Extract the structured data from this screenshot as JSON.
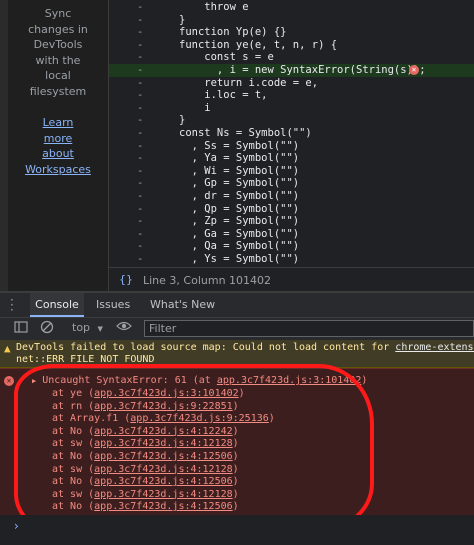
{
  "sidebar": {
    "lines": [
      "Sync",
      "changes in",
      "DevTools",
      "with the",
      "local",
      "filesystem"
    ],
    "link_lines": [
      "Learn",
      "more",
      "about",
      "Workspaces"
    ]
  },
  "editor": {
    "lines": [
      {
        "gutter": "-",
        "code": "    throw e"
      },
      {
        "gutter": "-",
        "code": "}"
      },
      {
        "gutter": "-",
        "code": "function Yp(e) {}"
      },
      {
        "gutter": "-",
        "code": "function ye(e, t, n, r) {"
      },
      {
        "gutter": "-",
        "code": "    const s = e"
      },
      {
        "gutter": "-",
        "code": "      , i = new SyntaxError(String(s));",
        "highlight": true,
        "error": true
      },
      {
        "gutter": "-",
        "code": "    return i.code = e,"
      },
      {
        "gutter": "-",
        "code": "    i.loc = t,"
      },
      {
        "gutter": "-",
        "code": "    i"
      },
      {
        "gutter": "-",
        "code": "}"
      },
      {
        "gutter": "-",
        "code": "const Ns = Symbol(\"\")"
      },
      {
        "gutter": "-",
        "code": "  , Ss = Symbol(\"\")"
      },
      {
        "gutter": "-",
        "code": "  , Ya = Symbol(\"\")"
      },
      {
        "gutter": "-",
        "code": "  , Wi = Symbol(\"\")"
      },
      {
        "gutter": "-",
        "code": "  , Gp = Symbol(\"\")"
      },
      {
        "gutter": "-",
        "code": "  , dr = Symbol(\"\")"
      },
      {
        "gutter": "-",
        "code": "  , Qp = Symbol(\"\")"
      },
      {
        "gutter": "-",
        "code": "  , Zp = Symbol(\"\")"
      },
      {
        "gutter": "-",
        "code": "  , Ga = Symbol(\"\")"
      },
      {
        "gutter": "-",
        "code": "  , Qa = Symbol(\"\")"
      },
      {
        "gutter": "-",
        "code": "  , Ys = Symbol(\"\")"
      }
    ],
    "error_glyph": "✕"
  },
  "status": {
    "braces": "{}",
    "position": "Line 3, Column 101402"
  },
  "tabs": [
    "Console",
    "Issues",
    "What's New"
  ],
  "toolbar": {
    "context": "top",
    "context_arrow": "▼",
    "filter_placeholder": "Filter"
  },
  "warning": {
    "icon": "▲",
    "text": "DevTools failed to load source map: Could not load content for ",
    "link": "chrome-extensi",
    "line2": "net::ERR_FILE_NOT_FOUND"
  },
  "error": {
    "icon": "✕",
    "arrow": "▶",
    "message": "Uncaught SyntaxError: 61 (at ",
    "message_link": "app.3c7f423d.js:3:101402",
    "message_close": ")",
    "frames": [
      {
        "prefix": "at ye (",
        "link": "app.3c7f423d.js:3:101402",
        "suffix": ")"
      },
      {
        "prefix": "at rn (",
        "link": "app.3c7f423d.js:9:22851",
        "suffix": ")"
      },
      {
        "prefix": "at Array.f1 (",
        "link": "app.3c7f423d.js:9:25136",
        "suffix": ")"
      },
      {
        "prefix": "at No (",
        "link": "app.3c7f423d.js:4:12242",
        "suffix": ")"
      },
      {
        "prefix": "at sw (",
        "link": "app.3c7f423d.js:4:12128",
        "suffix": ")"
      },
      {
        "prefix": "at No (",
        "link": "app.3c7f423d.js:4:12506",
        "suffix": ")"
      },
      {
        "prefix": "at sw (",
        "link": "app.3c7f423d.js:4:12128",
        "suffix": ")"
      },
      {
        "prefix": "at No (",
        "link": "app.3c7f423d.js:4:12506",
        "suffix": ")"
      },
      {
        "prefix": "at sw (",
        "link": "app.3c7f423d.js:4:12128",
        "suffix": ")"
      },
      {
        "prefix": "at No (",
        "link": "app.3c7f423d.js:4:12506",
        "suffix": ")"
      }
    ]
  },
  "prompt": {
    "caret": "›"
  },
  "colors": {
    "annotation": "#ff1a1a",
    "error_bg": "#3d1e1e",
    "warning_bg": "#413c26",
    "accent": "#8ab4f8"
  }
}
